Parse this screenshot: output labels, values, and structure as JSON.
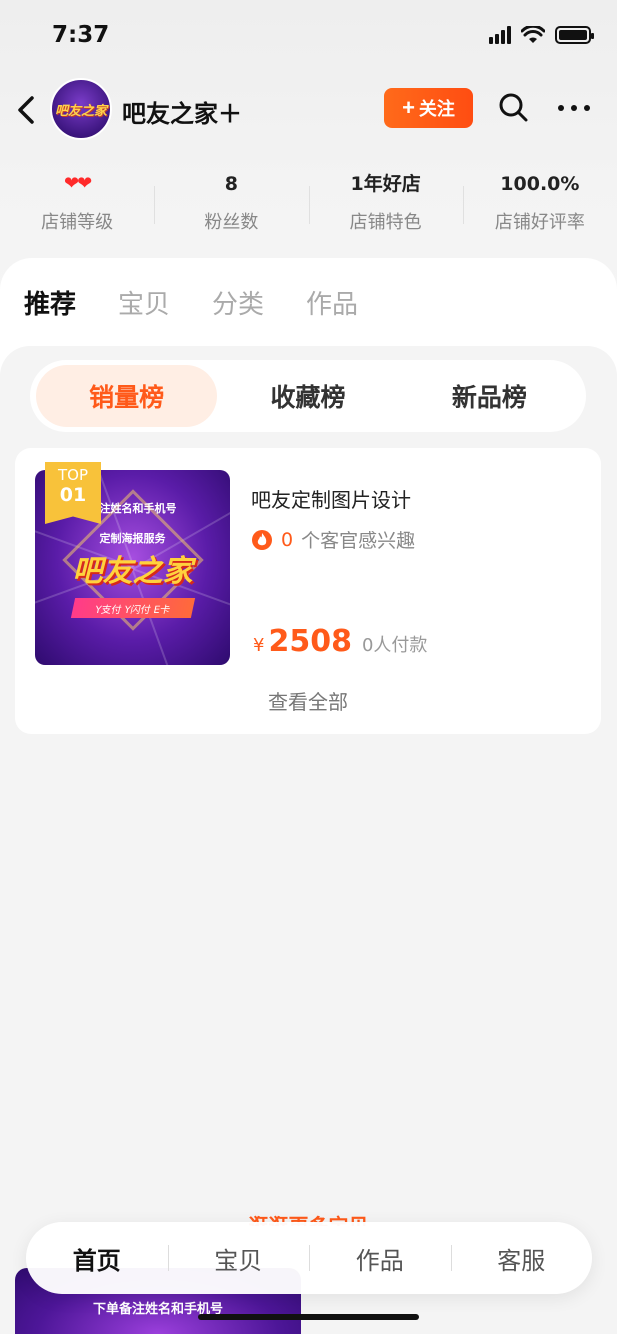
{
  "status": {
    "time": "7:37"
  },
  "header": {
    "shop_name": "吧友之家＋",
    "avatar_text": "吧友之家",
    "follow_label": "关注"
  },
  "stats": [
    {
      "value": "",
      "label": "店铺等级",
      "hearts": "❤❤"
    },
    {
      "value": "8",
      "label": "粉丝数"
    },
    {
      "value": "1年好店",
      "label": "店铺特色"
    },
    {
      "value": "100.0%",
      "label": "店铺好评率"
    }
  ],
  "tabs": [
    "推荐",
    "宝贝",
    "分类",
    "作品"
  ],
  "ranking": {
    "options": [
      "销量榜",
      "收藏榜",
      "新品榜"
    ],
    "active": "销量榜"
  },
  "product": {
    "badge_top": "TOP",
    "badge_rank": "01",
    "image_line1": "备注姓名和手机号",
    "image_line2": "定制海报服务",
    "image_brand": "吧友之家",
    "image_pay": "Y支付 Y闪付 E卡",
    "title": "吧友定制图片设计",
    "interest_count": "0",
    "interest_text": "个客官感兴趣",
    "currency": "¥",
    "price": "2508",
    "paid": "0人付款",
    "view_all": "查看全部"
  },
  "more_label": "逛逛更多宝贝",
  "peek_card_text": "下单备注姓名和手机号",
  "bottom_nav": [
    "首页",
    "宝贝",
    "作品",
    "客服"
  ],
  "colors": {
    "accent": "#ff5a1a",
    "badge": "#f8c23a"
  }
}
